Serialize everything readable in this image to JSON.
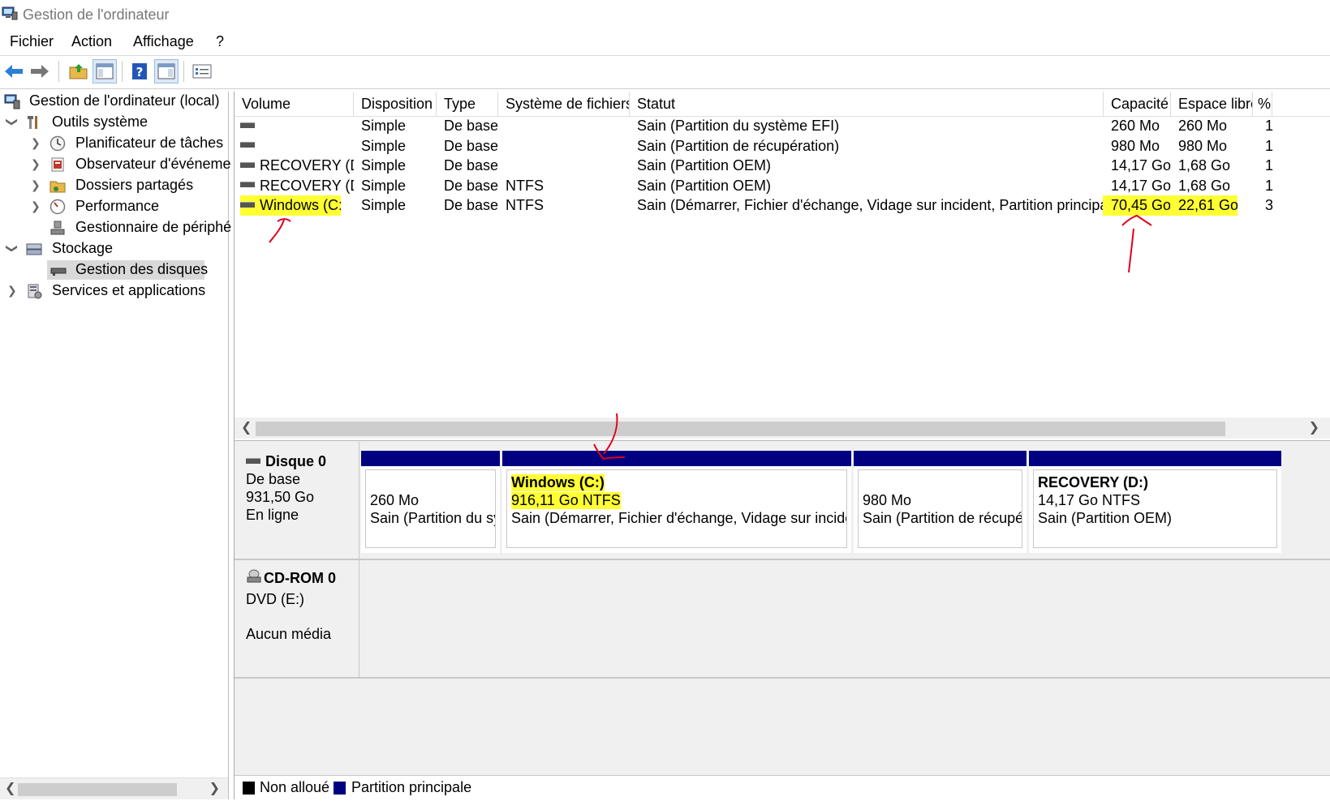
{
  "window": {
    "title": "Gestion de l'ordinateur"
  },
  "menu": [
    "Fichier",
    "Action",
    "Affichage",
    "?"
  ],
  "tree": {
    "root": "Gestion de l'ordinateur (local)",
    "system_tools": "Outils système",
    "task_scheduler": "Planificateur de tâches",
    "event_viewer": "Observateur d'événeme",
    "shared_folders": "Dossiers partagés",
    "performance": "Performance",
    "device_manager": "Gestionnaire de périphé",
    "storage": "Stockage",
    "disk_management": "Gestion des disques",
    "services": "Services et applications"
  },
  "columns": [
    "Volume",
    "Disposition",
    "Type",
    "Système de fichiers",
    "Statut",
    "Capacité",
    "Espace libre",
    "%"
  ],
  "volumes": [
    {
      "volume": "",
      "disposition": "Simple",
      "type": "De base",
      "fs": "",
      "statut": "Sain (Partition du système EFI)",
      "capacite": "260 Mo",
      "libre": "260 Mo",
      "pct": "1"
    },
    {
      "volume": "",
      "disposition": "Simple",
      "type": "De base",
      "fs": "",
      "statut": "Sain (Partition de récupération)",
      "capacite": "980 Mo",
      "libre": "980 Mo",
      "pct": "1"
    },
    {
      "volume": "RECOVERY (D:)",
      "disposition": "Simple",
      "type": "De base",
      "fs": "",
      "statut": "Sain (Partition OEM)",
      "capacite": "14,17 Go",
      "libre": "1,68 Go",
      "pct": "1"
    },
    {
      "volume": "RECOVERY (D:)",
      "disposition": "Simple",
      "type": "De base",
      "fs": "NTFS",
      "statut": "Sain (Partition OEM)",
      "capacite": "14,17 Go",
      "libre": "1,68 Go",
      "pct": "1"
    },
    {
      "volume": "Windows (C:)",
      "disposition": "Simple",
      "type": "De base",
      "fs": "NTFS",
      "statut": "Sain (Démarrer, Fichier d'échange, Vidage sur incident, Partition principale)",
      "capacite": "70,45 Go",
      "libre": "22,61 Go",
      "pct": "3"
    }
  ],
  "disk0": {
    "name": "Disque 0",
    "type": "De base",
    "size": "931,50 Go",
    "state": "En ligne",
    "partitions": [
      {
        "title": "",
        "size": "260 Mo",
        "status": "Sain (Partition du sy"
      },
      {
        "title": "Windows  (C:)",
        "size": "916,11 Go NTFS",
        "status": "Sain (Démarrer, Fichier d'échange, Vidage sur incident,"
      },
      {
        "title": "",
        "size": "980 Mo",
        "status": "Sain (Partition de récupér"
      },
      {
        "title": "RECOVERY  (D:)",
        "size": "14,17 Go NTFS",
        "status": "Sain (Partition OEM)"
      }
    ]
  },
  "cdrom0": {
    "name": "CD-ROM 0",
    "drive": "DVD (E:)",
    "media": "Aucun média"
  },
  "legend": {
    "unallocated": "Non alloué",
    "primary": "Partition principale"
  },
  "colors": {
    "primary_partition": "#000080",
    "unallocated": "#000000",
    "highlight": "#ffff33",
    "annotation": "#e0001a"
  }
}
